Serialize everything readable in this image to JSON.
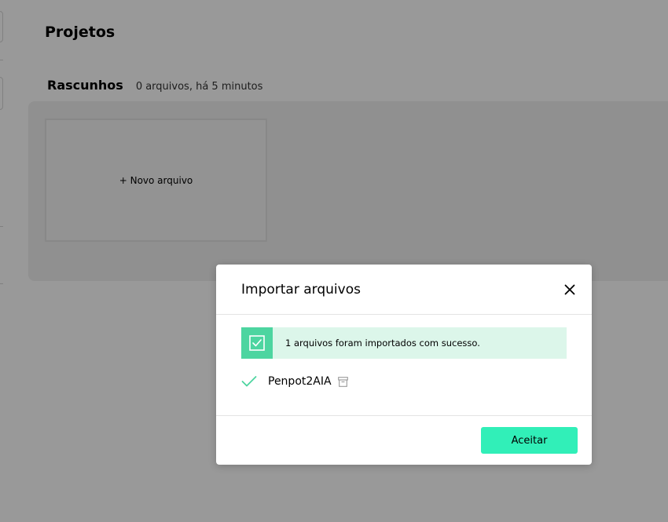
{
  "page": {
    "title": "Projetos"
  },
  "drafts": {
    "title": "Rascunhos",
    "meta": "0 arquivos, há 5 minutos",
    "new_file_label": "+ Novo arquivo"
  },
  "modal": {
    "title": "Importar arquivos",
    "close_icon": "close-icon",
    "banner_text": "1 arquivos foram importados com sucesso.",
    "files": [
      {
        "name": "Penpot2AIA",
        "status_icon": "check-icon",
        "type_icon": "archive-icon"
      }
    ],
    "accept_label": "Aceitar"
  },
  "colors": {
    "accent": "#31efb8",
    "success_bg": "#dcf6ea",
    "success_icon_bg": "#4dd5a0",
    "check_color": "#4dd5a0",
    "overlay": "rgba(0,0,0,0.4)"
  }
}
